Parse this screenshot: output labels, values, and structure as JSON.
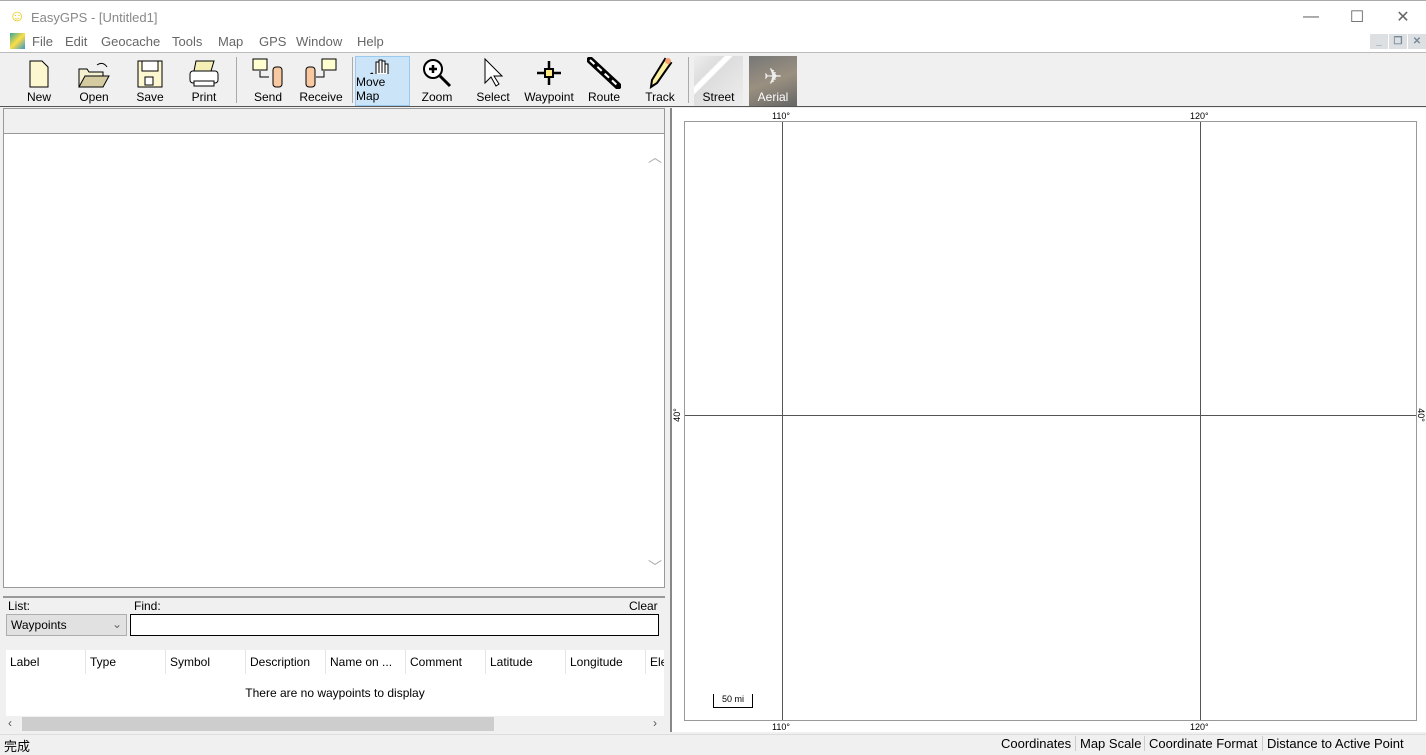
{
  "window": {
    "title": "EasyGPS - [Untitled1]"
  },
  "menu": [
    "File",
    "Edit",
    "Geocache",
    "Tools",
    "Map",
    "GPS",
    "Window",
    "Help"
  ],
  "toolbar": [
    "New",
    "Open",
    "Save",
    "Print",
    "Send",
    "Receive",
    "Move Map",
    "Zoom",
    "Select",
    "Waypoint",
    "Route",
    "Track",
    "Street",
    "Aerial"
  ],
  "toolbar_active": "Move Map",
  "list": {
    "list_label": "List:",
    "find_label": "Find:",
    "clear_label": "Clear",
    "selected": "Waypoints",
    "find_value": "",
    "columns": [
      "Label",
      "Type",
      "Symbol",
      "Description",
      "Name on ...",
      "Comment",
      "Latitude",
      "Longitude",
      "Ele"
    ],
    "empty_message": "There are no waypoints to display"
  },
  "map": {
    "lon_labels": [
      "110°",
      "120°"
    ],
    "lat_label": "40°",
    "scale": "50 mi"
  },
  "status": {
    "left": "完成",
    "panels": [
      "Coordinates",
      "Map Scale",
      "Coordinate Format",
      "Distance to Active Point"
    ]
  }
}
